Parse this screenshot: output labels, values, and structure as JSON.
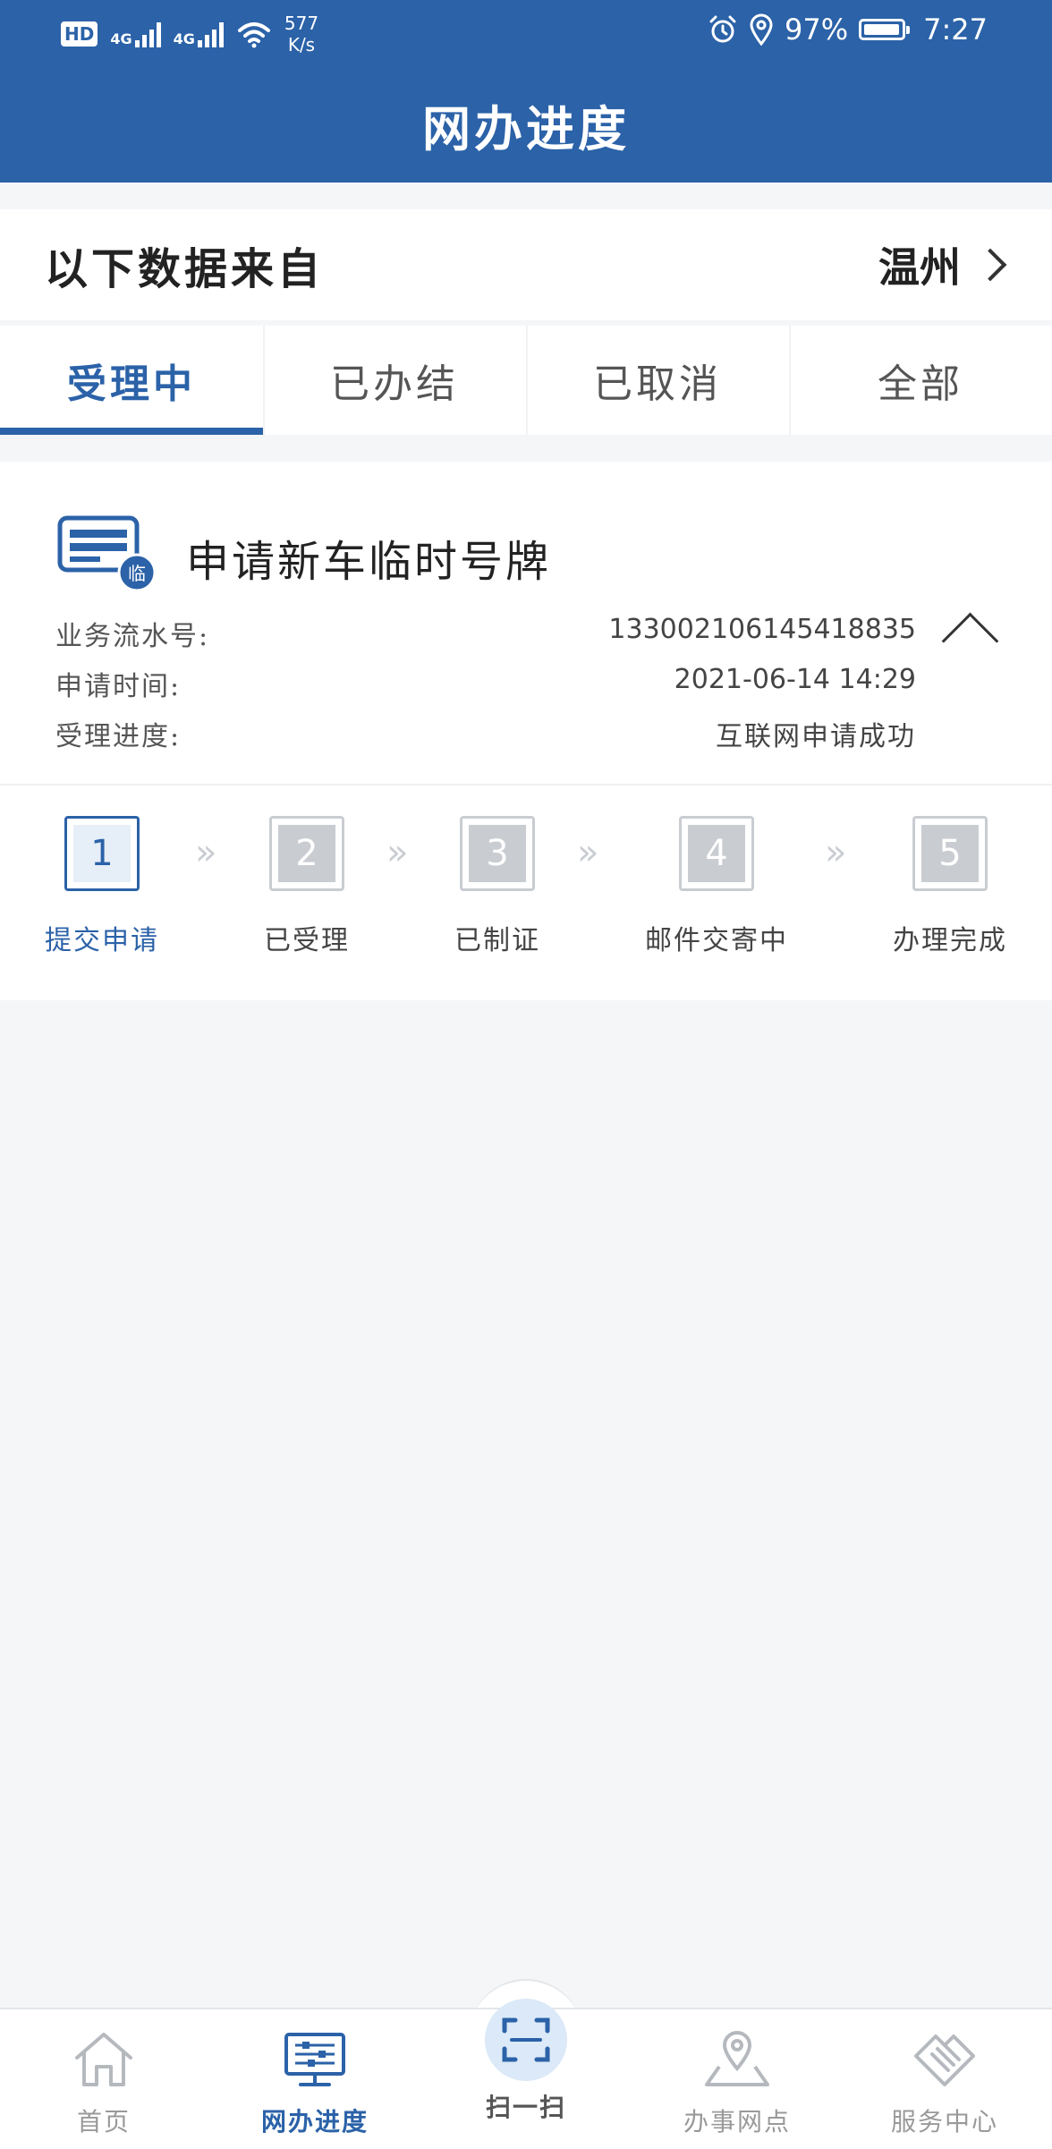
{
  "status_bar": {
    "hd": "HD",
    "sim1_network": "4G",
    "sim2_network": "4G",
    "speed_value": "577",
    "speed_unit": "K/s",
    "battery": "97%",
    "battery_level": 0.97,
    "time": "7:27",
    "icons": [
      "alarm-icon",
      "location-icon",
      "wifi-icon",
      "battery-icon",
      "signal-icon"
    ]
  },
  "header": {
    "title": "网办进度"
  },
  "source": {
    "label": "以下数据来自",
    "city": "温州"
  },
  "tabs": [
    {
      "label": "受理中",
      "active": true
    },
    {
      "label": "已办结",
      "active": false
    },
    {
      "label": "已取消",
      "active": false
    },
    {
      "label": "全部",
      "active": false
    }
  ],
  "record": {
    "icon_badge": "临",
    "title": "申请新车临时号牌",
    "fields": [
      {
        "label": "业务流水号:",
        "value": "133002106145418835"
      },
      {
        "label": "申请时间:",
        "value": "2021-06-14 14:29"
      },
      {
        "label": "受理进度:",
        "value": "互联网申请成功"
      }
    ],
    "steps": [
      {
        "num": "1",
        "label": "提交申请",
        "active": true
      },
      {
        "num": "2",
        "label": "已受理",
        "active": false
      },
      {
        "num": "3",
        "label": "已制证",
        "active": false
      },
      {
        "num": "4",
        "label": "邮件交寄中",
        "active": false
      },
      {
        "num": "5",
        "label": "办理完成",
        "active": false
      }
    ],
    "step_separator": "»"
  },
  "bottom_nav": [
    {
      "label": "首页",
      "icon": "home-icon"
    },
    {
      "label": "网办进度",
      "icon": "monitor-icon",
      "active": true
    },
    {
      "label": "扫一扫",
      "icon": "scan-icon"
    },
    {
      "label": "办事网点",
      "icon": "map-pin-icon"
    },
    {
      "label": "服务中心",
      "icon": "handshake-icon"
    }
  ],
  "colors": {
    "primary": "#2b62a8",
    "inactive": "#c9ccd1",
    "background": "#f4f6f8"
  }
}
